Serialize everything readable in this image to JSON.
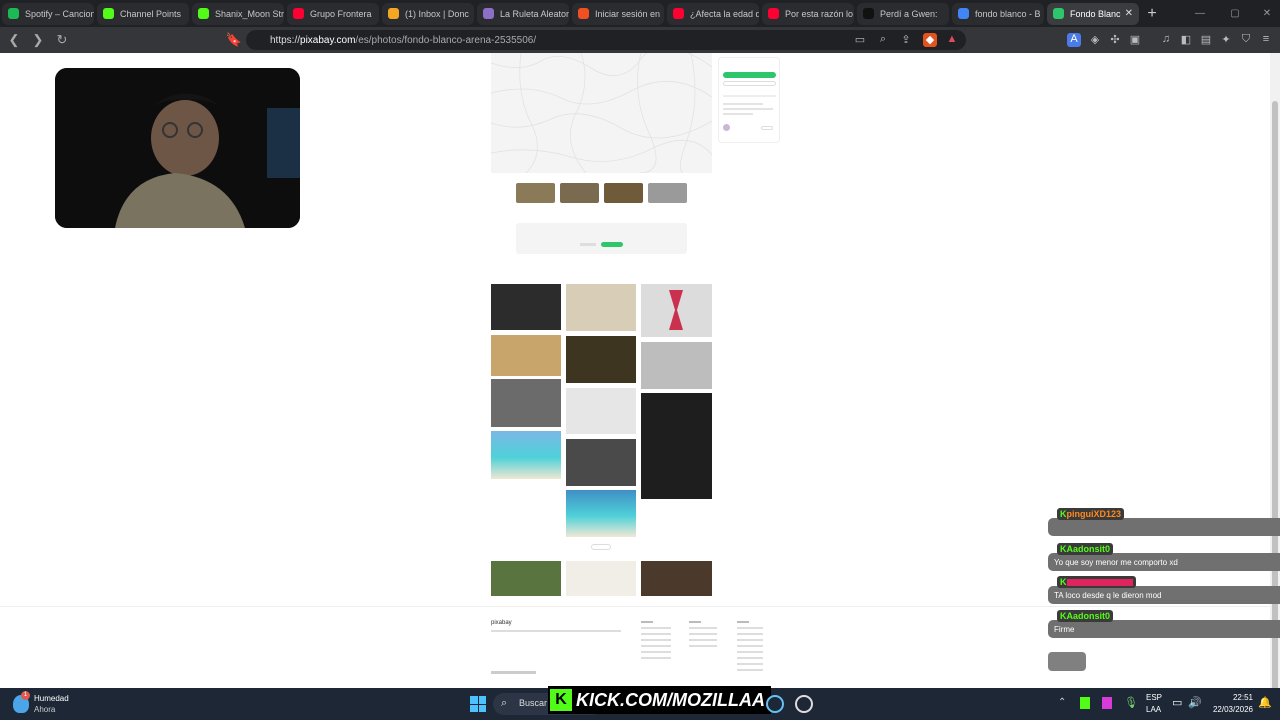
{
  "tabs": [
    {
      "label": "Spotify – Cancion",
      "color": "#1db954"
    },
    {
      "label": "Channel Points",
      "color": "#53fc18"
    },
    {
      "label": "Shanix_Moon Str",
      "color": "#53fc18"
    },
    {
      "label": "Grupo Frontera",
      "color": "#ff0033"
    },
    {
      "label": "(1) Inbox | Donc",
      "color": "#f5a623"
    },
    {
      "label": "La Ruleta Aleator",
      "color": "#8e6fc8"
    },
    {
      "label": "Iniciar sesión en",
      "color": "#f25022"
    },
    {
      "label": "¿Afecta la edad d",
      "color": "#ff0033"
    },
    {
      "label": "Por esta razón lo",
      "color": "#ff0033"
    },
    {
      "label": "Perdí a Gwen:",
      "color": "#111111"
    },
    {
      "label": "fondo blanco - B",
      "color": "#4285f4"
    },
    {
      "label": "Fondo Blanc",
      "color": "#2ec66d",
      "active": true
    }
  ],
  "address": {
    "scheme": "https://",
    "host": "pixabay.com",
    "path": "/es/photos/fondo-blanco-arena-2535506/"
  },
  "page": {
    "logo": "pixabay"
  },
  "chat": [
    {
      "user": "pinguiXD123",
      "user_color": "#ff8a1f",
      "message": ""
    },
    {
      "user": "Aadonsit0",
      "user_color": "#53fc18",
      "message": "Yo que soy menor me comporto xd"
    },
    {
      "user": "",
      "user_color": "#e0245e",
      "message": "TA loco desde q le dieron mod"
    },
    {
      "user": "Aadonsit0",
      "user_color": "#53fc18",
      "message": "Firme"
    }
  ],
  "taskbar": {
    "weather_title": "Humedad",
    "weather_sub": "Ahora",
    "weather_badge": "1",
    "search_label": "Buscar",
    "kick_banner": "KICK.COM/MOZILLAA",
    "lang_top": "ESP",
    "lang_bottom": "LAA",
    "time": "22:51",
    "date": "22/03/2026"
  }
}
